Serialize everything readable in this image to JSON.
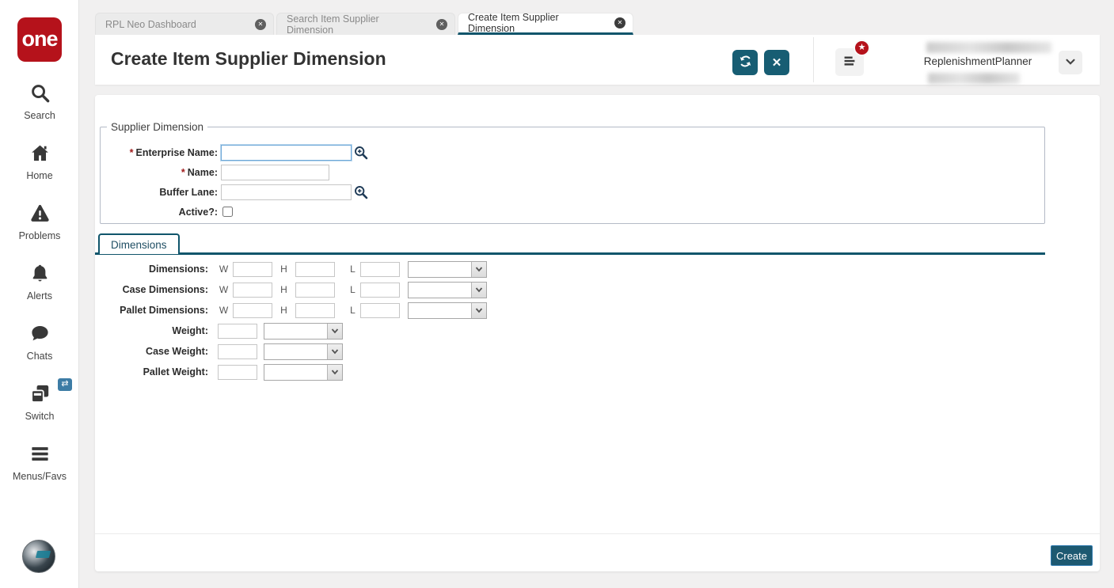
{
  "colors": {
    "accent_teal": "#175d73",
    "tab_underline_teal": "#10556b",
    "logo_red": "#b5121b",
    "badge_red": "#b5121b",
    "switch_badge_blue": "#3d7ca5",
    "create_button_bg": "#1d5971",
    "focused_input_border": "#6ea8d8"
  },
  "icons": {
    "tab_close": "✕",
    "close": "✕",
    "star": "★",
    "swap": "⇄"
  },
  "logo": {
    "text": "one"
  },
  "sidebar": {
    "items": [
      {
        "id": "search",
        "label": "Search"
      },
      {
        "id": "home",
        "label": "Home"
      },
      {
        "id": "problems",
        "label": "Problems"
      },
      {
        "id": "alerts",
        "label": "Alerts"
      },
      {
        "id": "chats",
        "label": "Chats"
      },
      {
        "id": "switch",
        "label": "Switch"
      },
      {
        "id": "menus-favs",
        "label": "Menus/Favs"
      }
    ]
  },
  "tabs": [
    {
      "label": "RPL Neo Dashboard",
      "active": false
    },
    {
      "label": "Search Item Supplier Dimension",
      "active": false
    },
    {
      "label": "Create Item Supplier Dimension",
      "active": true
    }
  ],
  "header": {
    "title": "Create Item Supplier Dimension",
    "user_role": "ReplenishmentPlanner"
  },
  "supplier_dimension": {
    "legend": "Supplier Dimension",
    "fields": {
      "enterprise_name": {
        "label": "Enterprise Name:",
        "required_marker": "*",
        "value": "",
        "focused": true,
        "has_lookup": true
      },
      "name": {
        "label": "Name:",
        "required_marker": "*",
        "value": ""
      },
      "buffer_lane": {
        "label": "Buffer Lane:",
        "value": "",
        "has_lookup": true
      },
      "active": {
        "label": "Active?:",
        "checked": false
      }
    }
  },
  "dimensions_tab": {
    "tab_label": "Dimensions",
    "axis_labels": {
      "w": "W",
      "h": "H",
      "l": "L"
    },
    "dimension_rows": [
      {
        "label": "Dimensions:",
        "w": "",
        "h": "",
        "l": "",
        "uom": ""
      },
      {
        "label": "Case Dimensions:",
        "w": "",
        "h": "",
        "l": "",
        "uom": ""
      },
      {
        "label": "Pallet Dimensions:",
        "w": "",
        "h": "",
        "l": "",
        "uom": ""
      }
    ],
    "weight_rows": [
      {
        "label": "Weight:",
        "value": "",
        "uom": ""
      },
      {
        "label": "Case Weight:",
        "value": "",
        "uom": ""
      },
      {
        "label": "Pallet Weight:",
        "value": "",
        "uom": ""
      }
    ]
  },
  "footer": {
    "create_label": "Create"
  }
}
